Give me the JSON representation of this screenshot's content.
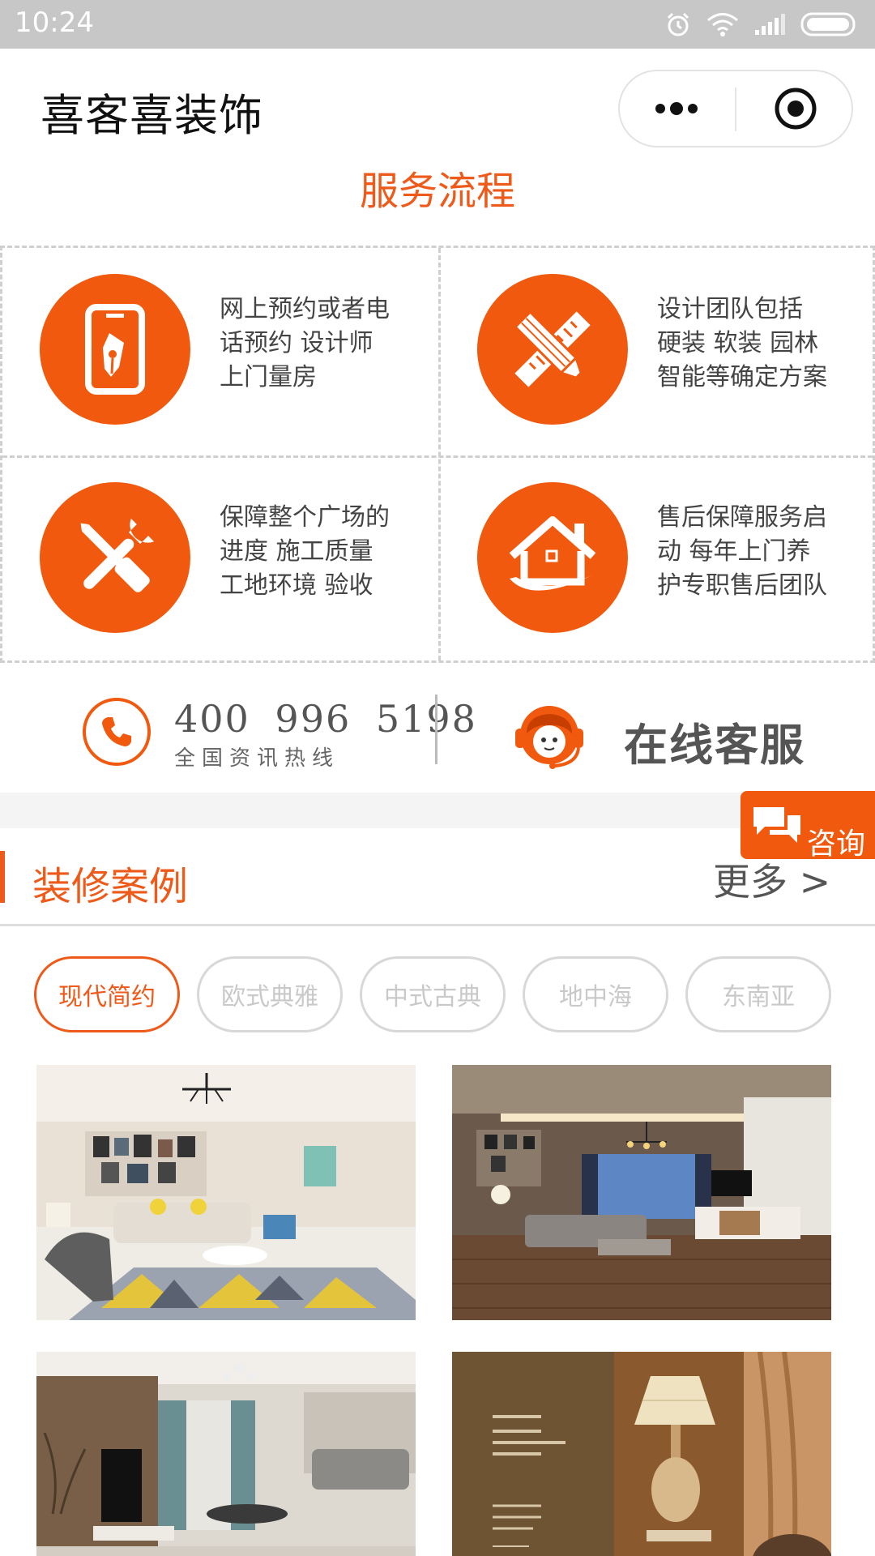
{
  "status": {
    "time": "10:24"
  },
  "nav": {
    "title": "喜客喜装饰"
  },
  "process": {
    "title": "服务流程",
    "steps": [
      {
        "icon": "tablet-pen-icon",
        "lines": [
          "网上预约或者电",
          "话预约 设计师",
          "上门量房"
        ]
      },
      {
        "icon": "pencil-ruler-icon",
        "lines": [
          "设计团队包括",
          "硬装 软装 园林",
          "智能等确定方案"
        ]
      },
      {
        "icon": "wrench-screwdriver-icon",
        "lines": [
          "保障整个广场的",
          "进度 施工质量",
          "工地环境 验收"
        ]
      },
      {
        "icon": "house-icon",
        "lines": [
          "售后保障服务启",
          "动 每年上门养",
          "护专职售后团队"
        ]
      }
    ]
  },
  "contact": {
    "phone": "400 996 5198",
    "phone_caption": "全国资讯热线",
    "service_label": "在线客服"
  },
  "consult_label": "咨询",
  "cases": {
    "title": "装修案例",
    "more": "更多 >",
    "filters": [
      "现代简约",
      "欧式典雅",
      "中式古典",
      "地中海",
      "东南亚"
    ],
    "active_filter": "现代简约"
  },
  "colors": {
    "accent": "#f15a0e",
    "accent_text": "#ee5a19"
  }
}
